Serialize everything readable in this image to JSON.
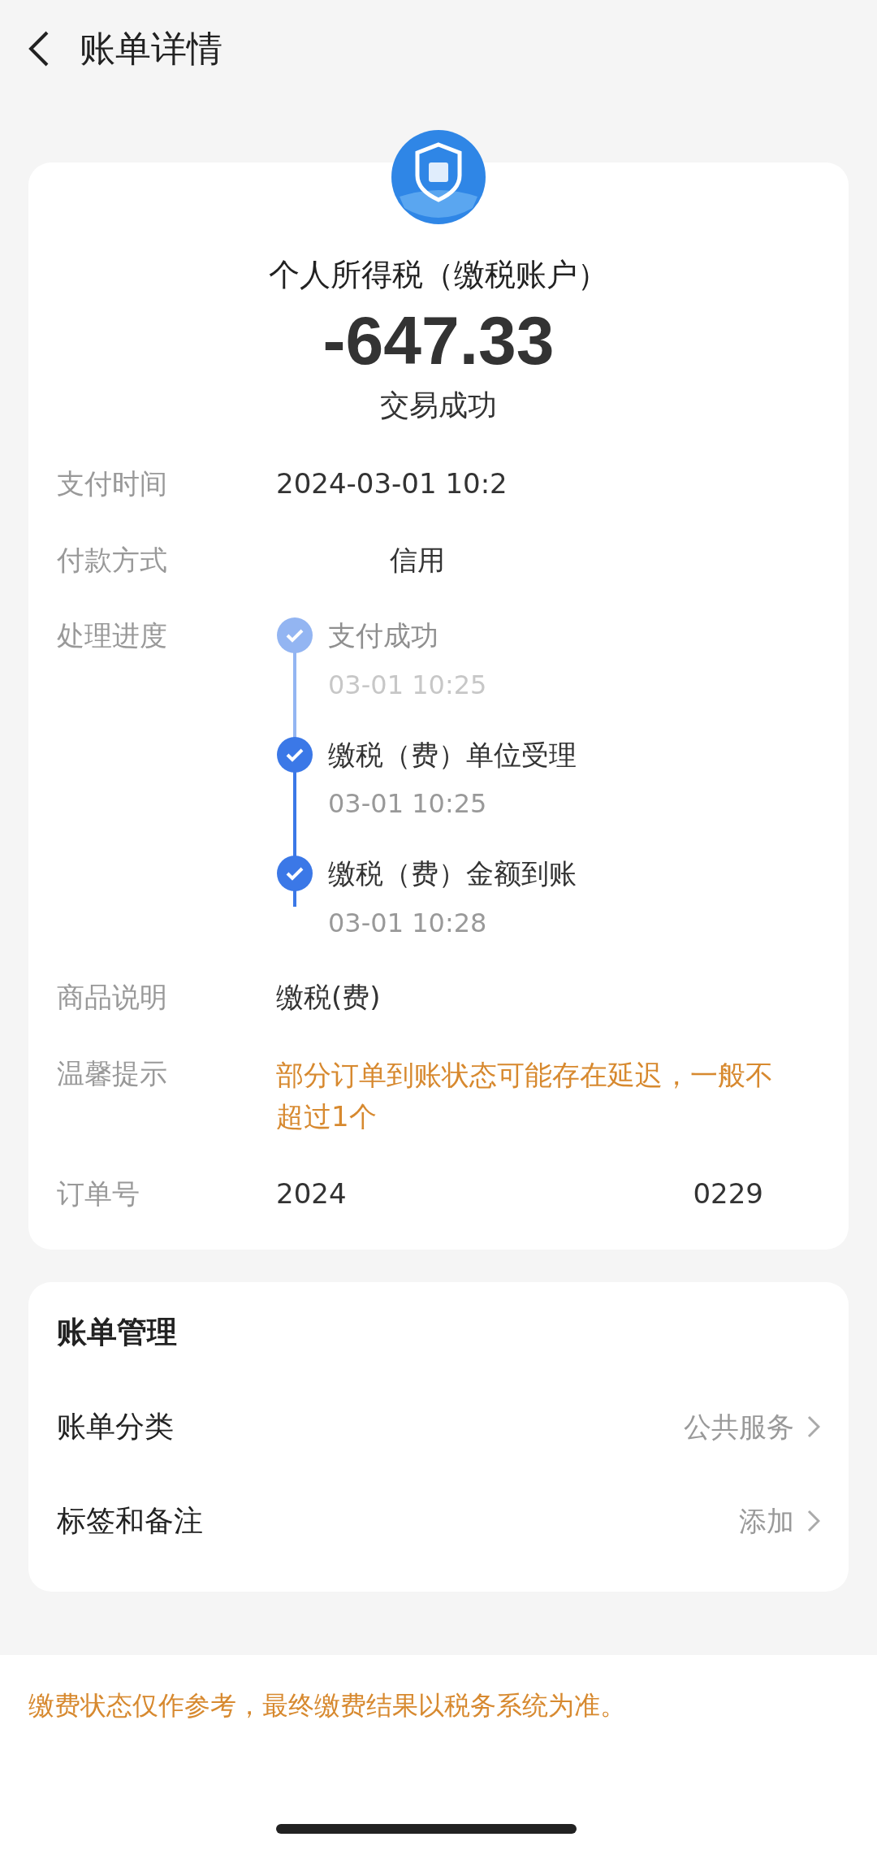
{
  "header": {
    "title": "账单详情"
  },
  "summary": {
    "merchant": "个人所得税（缴税账户）",
    "amount": "-647.33",
    "status": "交易成功"
  },
  "details": [
    {
      "kind": "text",
      "label": "支付时间",
      "value": "2024-03-01 10:2"
    },
    {
      "kind": "text",
      "label": "付款方式",
      "value": "信用",
      "indent": true
    },
    {
      "kind": "progress",
      "label": "处理进度",
      "steps": [
        {
          "title": "支付成功",
          "time": "03-01 10:25",
          "faded": true
        },
        {
          "title": "缴税（费）单位受理",
          "time": "03-01 10:25",
          "faded": false
        },
        {
          "title": "缴税（费）金额到账",
          "time": "03-01 10:28",
          "faded": false
        }
      ]
    },
    {
      "kind": "text",
      "label": "商品说明",
      "value": "缴税(费)"
    },
    {
      "kind": "notice",
      "label": "温馨提示",
      "value": "部分订单到账状态可能存在延迟，一般不超过1个"
    },
    {
      "kind": "split",
      "label": "订单号",
      "value": "2024",
      "value_end": "0229"
    }
  ],
  "management": {
    "title": "账单管理",
    "items": [
      {
        "label": "账单分类",
        "value": "公共服务"
      },
      {
        "label": "标签和备注",
        "value": "添加"
      }
    ]
  },
  "footer_note": "缴费状态仅作参考，最终缴费结果以税务系统为准。"
}
